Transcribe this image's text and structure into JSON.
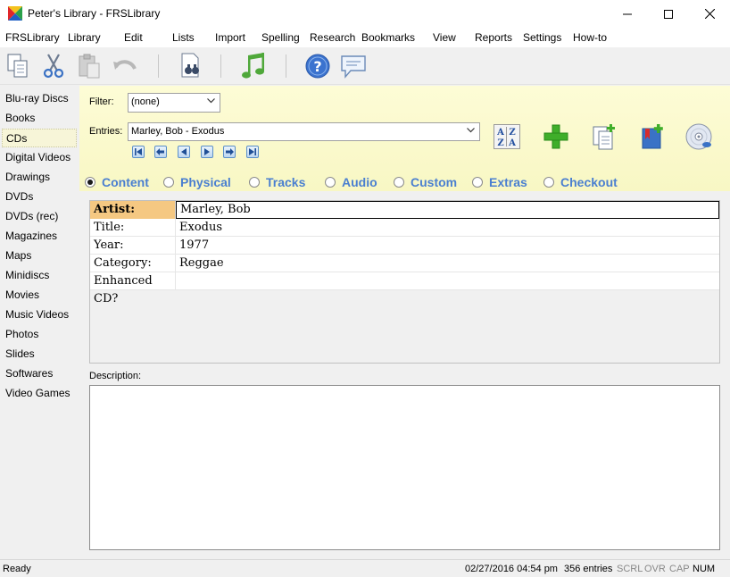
{
  "window": {
    "title": "Peter's Library - FRSLibrary"
  },
  "menu": [
    "FRSLibrary",
    "Library",
    "Edit",
    "Lists",
    "Import",
    "Spelling",
    "Research",
    "Bookmarks",
    "View",
    "Reports",
    "Settings",
    "How-to"
  ],
  "toolbar": {
    "icons": [
      "copy-icon",
      "cut-icon",
      "paste-icon",
      "undo-icon",
      "find-icon",
      "music-note-icon",
      "help-icon",
      "comment-icon"
    ]
  },
  "sidebar": {
    "items": [
      "Blu-ray Discs",
      "Books",
      "CDs",
      "Digital Videos",
      "Drawings",
      "DVDs",
      "DVDs (rec)",
      "Magazines",
      "Maps",
      "Minidiscs",
      "Movies",
      "Music Videos",
      "Photos",
      "Slides",
      "Softwares",
      "Video Games"
    ],
    "selected": "CDs"
  },
  "filter": {
    "label": "Filter:",
    "value": "(none)"
  },
  "entries": {
    "label": "Entries:",
    "value": "Marley, Bob - Exodus"
  },
  "tabs": [
    {
      "label": "Content",
      "selected": true
    },
    {
      "label": "Physical",
      "selected": false
    },
    {
      "label": "Tracks",
      "selected": false
    },
    {
      "label": "Audio",
      "selected": false
    },
    {
      "label": "Custom",
      "selected": false
    },
    {
      "label": "Extras",
      "selected": false
    },
    {
      "label": "Checkout",
      "selected": false
    }
  ],
  "fields": [
    {
      "key": "Artist:",
      "value": "Marley, Bob"
    },
    {
      "key": "Title:",
      "value": "Exodus"
    },
    {
      "key": "Year:",
      "value": "1977"
    },
    {
      "key": "Category:",
      "value": "Reggae"
    },
    {
      "key": "Enhanced CD?",
      "value": ""
    }
  ],
  "description": {
    "label": "Description:",
    "value": ""
  },
  "status": {
    "left": "Ready",
    "datetime": "02/27/2016 04:54 pm",
    "count": "356 entries",
    "scrl": "SCRL",
    "ovr": "OVR",
    "cap": "CAP",
    "num": "NUM"
  },
  "colors": {
    "header_bg": "#fdfcd6",
    "tab_label": "#4a7fd0",
    "active_key_bg": "#f5c882",
    "sidebar_selected_bg": "#f7f5d8"
  }
}
